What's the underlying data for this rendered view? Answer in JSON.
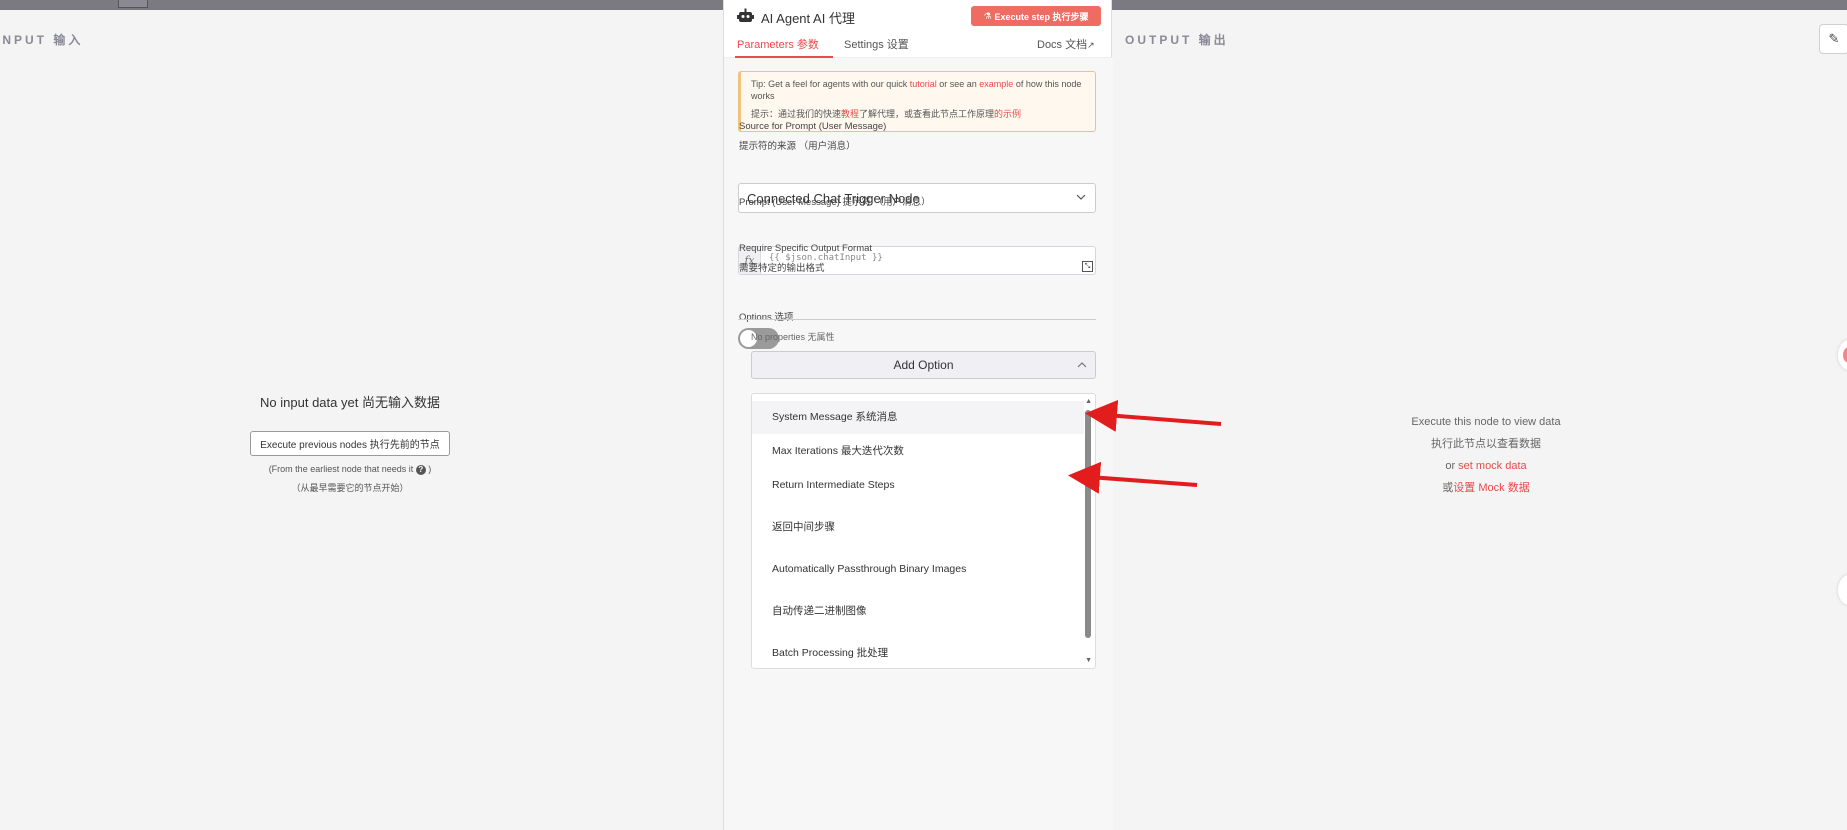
{
  "canvas": {
    "input_label": "INPUT  输入",
    "output_label": "OUTPUT  输出",
    "edit_icon": "pencil-icon"
  },
  "input_pane": {
    "title": "No input data yet  尚无输入数据",
    "button_label": "Execute previous nodes  执行先前的节点",
    "note": "(From the earliest node that needs it",
    "note_end": ")",
    "note_cn": "（从最早需要它的节点开始）"
  },
  "output_pane": {
    "line1": "Execute this node to view data",
    "line2": "执行此节点以查看数据",
    "or1": "or ",
    "mock_link": "set mock data",
    "or2": "或",
    "mock_link_cn": "设置 Mock 数据"
  },
  "panel": {
    "icon": "robot-icon",
    "title": "AI Agent   AI 代理",
    "execute_button": "Execute step  执行步骤",
    "tabs": {
      "parameters": "Parameters  参数",
      "settings": "Settings  设置",
      "docs": "Docs   文档"
    },
    "tip": {
      "prefix": "Tip: Get a feel for agents with our quick ",
      "tutorial": "tutorial",
      "middle": " or see an ",
      "example": "example",
      "suffix": " of how this node works",
      "cn_prefix": "提示：通过我们的快速",
      "cn_tutorial": "教程",
      "cn_middle": "了解代理，或查看此节点工作原理",
      "cn_example": "的示例"
    },
    "source_label": "Source for Prompt (User Message)",
    "source_label_cn": "提示符的来源 （用户消息）",
    "source_value": "Connected Chat Trigger Node",
    "prompt_label": "Prompt (User Message)  提示符 （用户消息）",
    "prompt_value": "{{ $json.chatInput }}",
    "format_label": "Require Specific Output Format",
    "format_label_cn": "需要特定的输出格式",
    "format_enabled": false,
    "options_label": "Options  选项",
    "no_properties": "No properties  无属性",
    "add_option": "Add Option",
    "option_items": [
      "System Message  系统消息",
      "Max Iterations  最大迭代次数",
      "Return Intermediate Steps",
      "返回中间步骤",
      "Automatically Passthrough Binary Images",
      "自动传递二进制图像",
      "Batch Processing  批处理"
    ]
  },
  "colors": {
    "accent": "#ea4b4b",
    "execute_button": "#ef6c63",
    "annotation_arrow": "#e11d1d"
  }
}
